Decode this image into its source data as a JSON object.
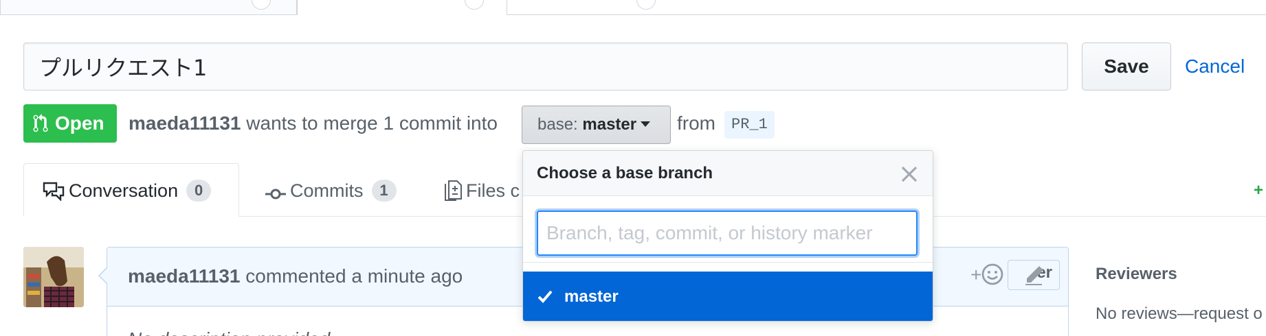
{
  "title_edit": {
    "value": "プルリクエスト1",
    "save_label": "Save",
    "cancel_label": "Cancel"
  },
  "state": {
    "label": "Open",
    "author": "maeda11131",
    "merge_text": "wants to merge 1 commit into",
    "base_prefix": "base:",
    "base_branch": "master",
    "from_label": "from",
    "head_branch": "PR_1"
  },
  "tabs": [
    {
      "label": "Conversation",
      "count": "0"
    },
    {
      "label": "Commits",
      "count": "1"
    },
    {
      "label": "Files c"
    }
  ],
  "tabs_right_fragment": "+",
  "branch_dropdown": {
    "title": "Choose a base branch",
    "filter_placeholder": "Branch, tag, commit, or history marker",
    "items": [
      {
        "label": "master",
        "selected": true
      }
    ]
  },
  "comment": {
    "author": "maeda11131",
    "action": "commented a minute ago",
    "badge_fragment": "er",
    "emoji_plus": "+",
    "body": "No description provided."
  },
  "sidebar": {
    "reviewers_heading": "Reviewers",
    "reviewers_text": "No reviews—request o"
  },
  "colors": {
    "open_green": "#2cbe4e",
    "link_blue": "#0366d6",
    "selected_item_bg": "#0366d6",
    "comment_header_bg": "#f1f8ff"
  }
}
